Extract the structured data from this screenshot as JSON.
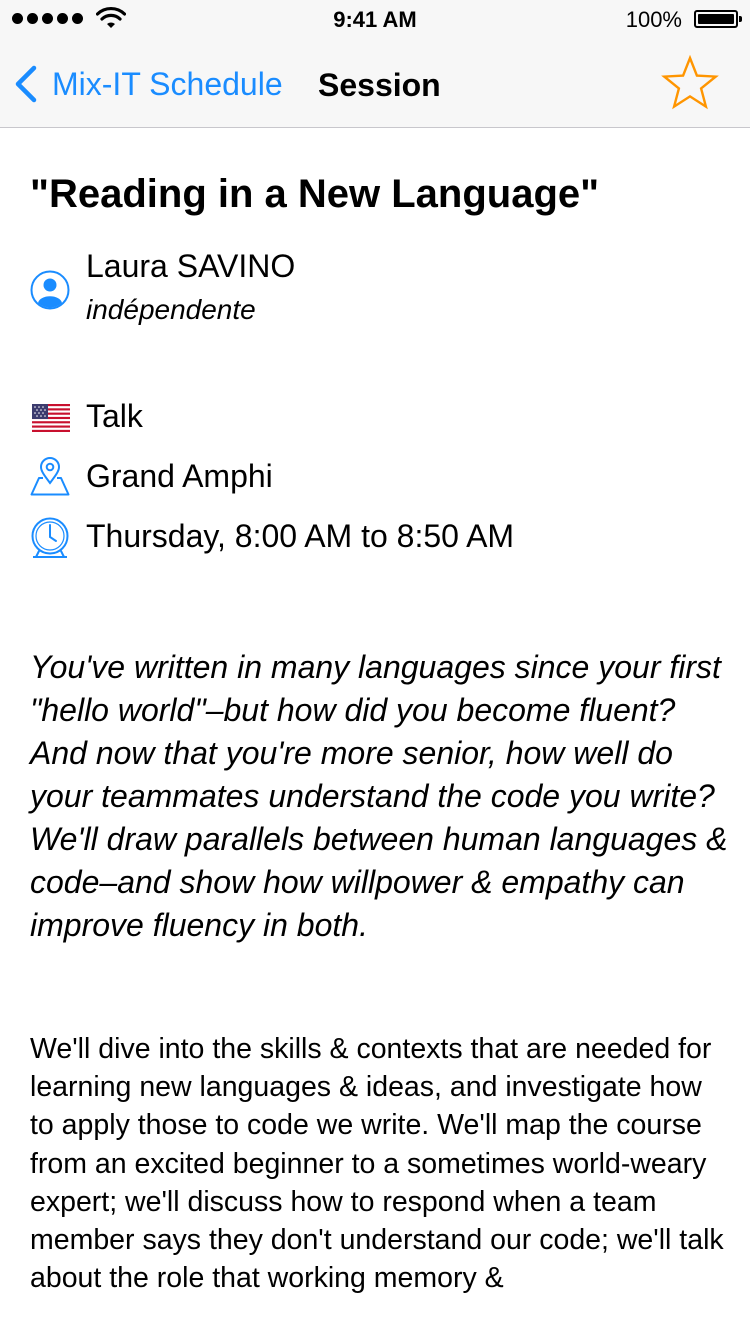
{
  "status_bar": {
    "time": "9:41 AM",
    "battery_percent": "100%",
    "signal_bars": 5,
    "battery_level": 1.0
  },
  "nav": {
    "back_label": "Mix-IT Schedule",
    "title": "Session",
    "favorite_icon": "star-outline-icon",
    "accent_color": "#1a8cff",
    "star_color": "#ff9500"
  },
  "session": {
    "title": "\"Reading in a New Language\"",
    "speaker": {
      "name": "Laura SAVINO",
      "company": "indépendente"
    },
    "language_flag": "us-flag-icon",
    "type": "Talk",
    "room": "Grand Amphi",
    "time": "Thursday, 8:00 AM to 8:50 AM",
    "abstract": "You've written in many languages since your first \"hello world\"–but how did you become fluent? And now that you're more senior, how well do your teammates understand the code you write? We'll draw parallels between human languages & code–and show how willpower & empathy can improve fluency in both.",
    "description": "We'll dive into the skills & contexts that are needed for learning new languages & ideas, and investigate how to apply those to code we write. We'll map the course from an excited beginner to a sometimes world-weary expert; we'll discuss how to respond when a team member says they don't understand our code; we'll talk about the role that working memory &"
  }
}
